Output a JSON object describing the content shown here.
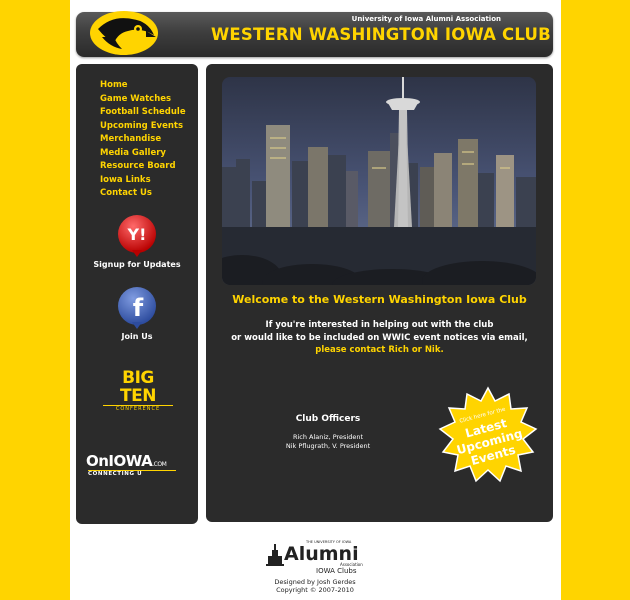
{
  "header": {
    "association": "University of Iowa Alumni Association",
    "title": "WESTERN WASHINGTON IOWA CLUB"
  },
  "nav": [
    "Home",
    "Game Watches",
    "Football Schedule",
    "Upcoming Events",
    "Merchandise",
    "Media Gallery",
    "Resource Board",
    "Iowa Links",
    "Contact Us"
  ],
  "sidebar": {
    "yahoo_caption": "Signup for Updates",
    "facebook_caption": "Join Us",
    "bigten_big": "BIG TEN",
    "bigten_conf": "CONFERENCE",
    "oniowa_word": "OnIOWA",
    "oniowa_com": ".COM",
    "oniowa_conn": "CONNECTING U"
  },
  "main": {
    "welcome": "Welcome to the Western Washington Iowa Club",
    "intro_line1": "If you're interested in helping out with the club",
    "intro_line2": "or would like to be included on WWIC event notices via email,",
    "intro_link": "please contact Rich or Nik",
    "intro_period": ".",
    "officers_title": "Club Officers",
    "officer1": "Rich Alaniz, President",
    "officer2": "Nik Pflugrath, V. President",
    "starburst_small": "Click here for the",
    "starburst_l1": "Latest",
    "starburst_l2": "Upcoming",
    "starburst_l3": "Events"
  },
  "footer": {
    "alumni_small": "THE UNIVERSITY OF IOWA",
    "alumni_word": "Alumni",
    "alumni_assoc": "Association",
    "alumni_clubs": "IOWA Clubs",
    "designed_by": "Designed by Josh Gerdes",
    "copyright": "Copyright © 2007-2010"
  },
  "colors": {
    "gold": "#ffd400",
    "panel": "#2b2b2b",
    "page": "#ffffff"
  }
}
